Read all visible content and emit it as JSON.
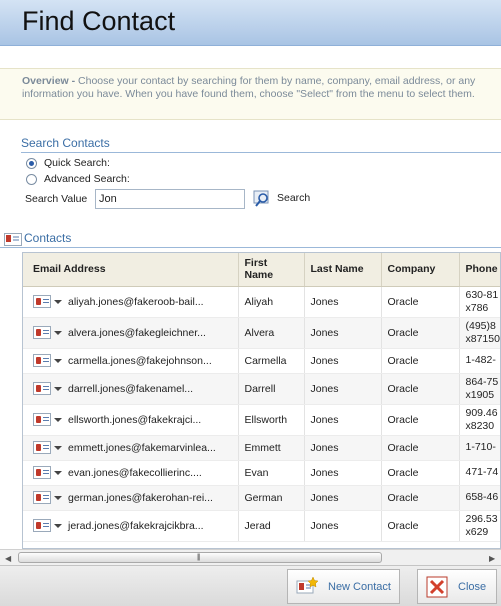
{
  "window": {
    "title": "Find Contact"
  },
  "overview": {
    "label": "Overview -",
    "text": "Choose your contact by searching for them by name, company, email address, or any information you have. When you have found them, choose \"Select\" from the menu to select them."
  },
  "search": {
    "section_title": "Search Contacts",
    "quick_label": "Quick Search:",
    "advanced_label": "Advanced Search:",
    "selected_mode": "quick",
    "value_label": "Search Value",
    "value": "Jon",
    "button_label": "Search"
  },
  "contacts": {
    "section_title": "Contacts",
    "columns": [
      "Email Address",
      "First Name",
      "Last Name",
      "Company",
      "Phone"
    ],
    "rows": [
      {
        "email": "aliyah.jones@fakeroob-bail...",
        "first": "Aliyah",
        "last": "Jones",
        "company": "Oracle",
        "phone": "630-81\nx786"
      },
      {
        "email": "alvera.jones@fakegleichner...",
        "first": "Alvera",
        "last": "Jones",
        "company": "Oracle",
        "phone": "(495)8\nx87150"
      },
      {
        "email": "carmella.jones@fakejohnson...",
        "first": "Carmella",
        "last": "Jones",
        "company": "Oracle",
        "phone": "1-482-"
      },
      {
        "email": "darrell.jones@fakenamel...",
        "first": "Darrell",
        "last": "Jones",
        "company": "Oracle",
        "phone": "864-75\nx1905"
      },
      {
        "email": "ellsworth.jones@fakekrajci...",
        "first": "Ellsworth",
        "last": "Jones",
        "company": "Oracle",
        "phone": "909.46\nx8230"
      },
      {
        "email": "emmett.jones@fakemarvinlea...",
        "first": "Emmett",
        "last": "Jones",
        "company": "Oracle",
        "phone": "1-710-"
      },
      {
        "email": "evan.jones@fakecollierinc....",
        "first": "Evan",
        "last": "Jones",
        "company": "Oracle",
        "phone": "471-74"
      },
      {
        "email": "german.jones@fakerohan-rei...",
        "first": "German",
        "last": "Jones",
        "company": "Oracle",
        "phone": "658-46"
      },
      {
        "email": "jerad.jones@fakekrajcikbra...",
        "first": "Jerad",
        "last": "Jones",
        "company": "Oracle",
        "phone": "296.53\nx629"
      }
    ]
  },
  "footer": {
    "new_contact_label": "New Contact",
    "close_label": "Close"
  }
}
